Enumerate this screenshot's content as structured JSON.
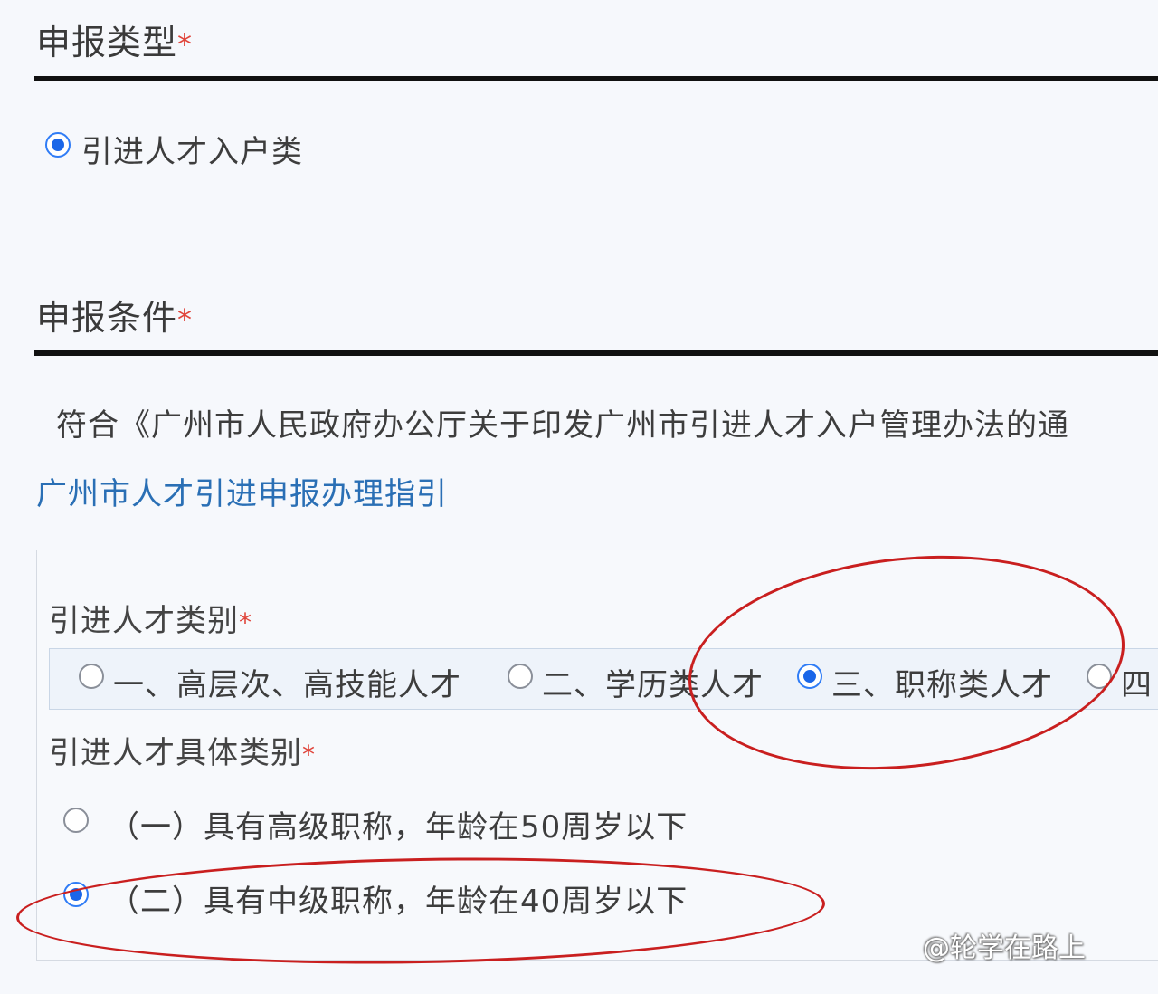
{
  "sections": {
    "type": {
      "title": "申报类型",
      "required_mark": "*",
      "option_label": "引进人才入户类"
    },
    "conditions": {
      "title": "申报条件",
      "required_mark": "*",
      "notice_text": "符合《广州市人民政府办公厅关于印发广州市引进人才入户管理办法的通",
      "guide_link": "广州市人才引进申报办理指引"
    }
  },
  "category": {
    "label": "引进人才类别",
    "required_mark": "*",
    "options": [
      {
        "label": "一、高层次、高技能人才",
        "selected": false
      },
      {
        "label": "二、学历类人才",
        "selected": false
      },
      {
        "label": "三、职称类人才",
        "selected": true
      },
      {
        "label": "四",
        "selected": false
      }
    ]
  },
  "subcategory": {
    "label": "引进人才具体类别",
    "required_mark": "*",
    "options": [
      {
        "label": "（一）具有高级职称，年龄在50周岁以下",
        "selected": false
      },
      {
        "label": "（二）具有中级职称，年龄在40周岁以下",
        "selected": true
      }
    ]
  },
  "watermark": "@轮学在路上",
  "colors": {
    "accent": "#1a66e8",
    "link": "#2a6fb5",
    "annotation": "#c91f1f",
    "required": "#e0443a"
  }
}
